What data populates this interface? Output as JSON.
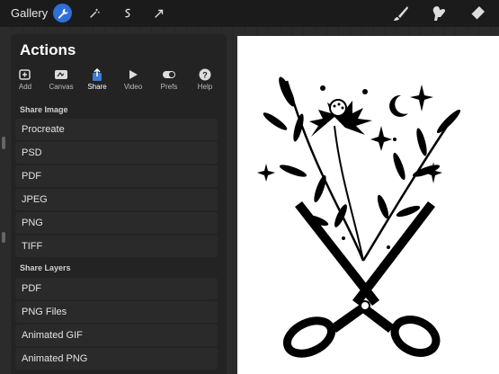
{
  "topbar": {
    "gallery_label": "Gallery",
    "tools": [
      {
        "icon": "wrench-icon",
        "active": true
      },
      {
        "icon": "magic-wand-icon",
        "active": false
      },
      {
        "icon": "selection-icon",
        "active": false
      },
      {
        "icon": "transform-arrow-icon",
        "active": false
      }
    ],
    "right_tools": [
      "brush-icon",
      "smudge-icon",
      "eraser-icon"
    ],
    "accent_color": "#2f6fd6"
  },
  "panel": {
    "title": "Actions",
    "tabs": [
      {
        "label": "Add",
        "icon": "add-image-icon"
      },
      {
        "label": "Canvas",
        "icon": "canvas-icon"
      },
      {
        "label": "Share",
        "icon": "share-icon",
        "selected": true
      },
      {
        "label": "Video",
        "icon": "play-icon"
      },
      {
        "label": "Prefs",
        "icon": "toggle-icon"
      },
      {
        "label": "Help",
        "icon": "help-icon"
      }
    ],
    "share_image": {
      "heading": "Share Image",
      "items": [
        "Procreate",
        "PSD",
        "PDF",
        "JPEG",
        "PNG",
        "TIFF"
      ]
    },
    "share_layers": {
      "heading": "Share Layers",
      "items": [
        "PDF",
        "PNG Files",
        "Animated GIF",
        "Animated PNG"
      ]
    }
  }
}
